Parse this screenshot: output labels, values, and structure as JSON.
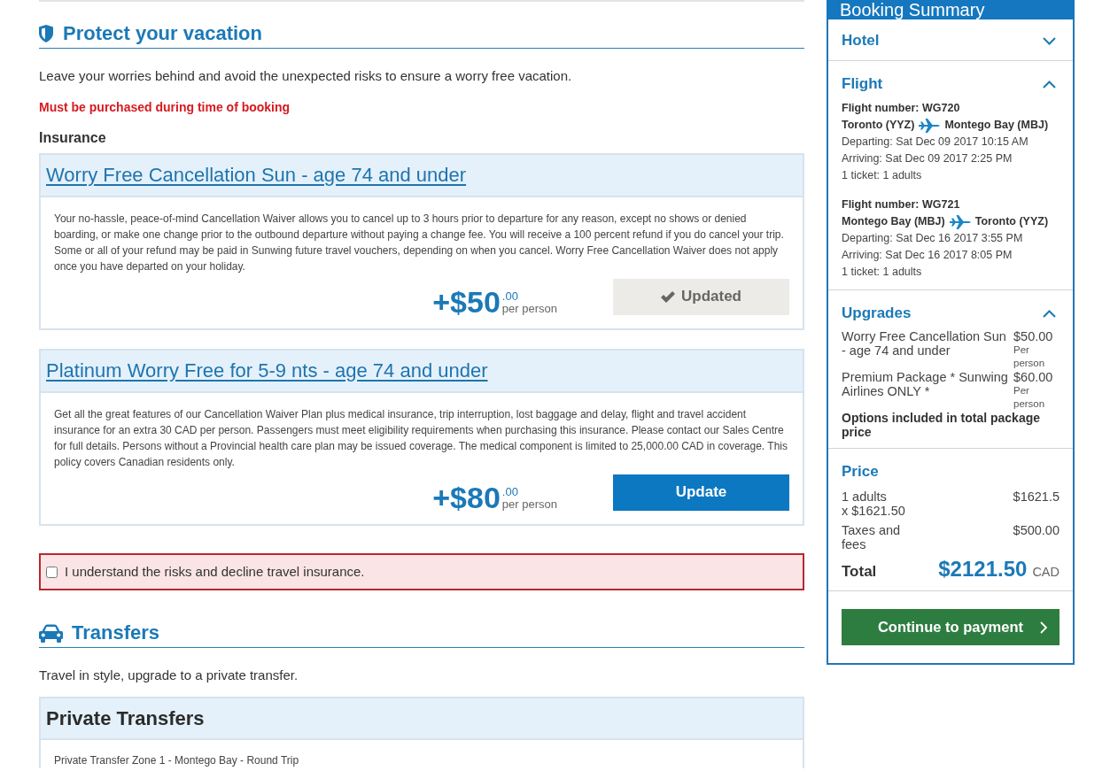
{
  "protect_section": {
    "title": "Protect your vacation",
    "description": "Leave your worries behind and avoid the unexpected risks to ensure a worry free vacation.",
    "warning": "Must be purchased during time of booking",
    "subheading": "Insurance",
    "plans": [
      {
        "title": "Worry Free Cancellation Sun - age 74 and under",
        "description": "Your no-hassle, peace-of-mind Cancellation Waiver allows you to cancel up to 3 hours prior to departure for any reason, except no shows or denied boarding, or make one change prior to the outbound departure without paying a change fee. You will receive a 100 percent refund if you do cancel your trip. Some or all of your refund may be paid in Sunwing future travel vouchers, depending on when you cancel. Worry Free Cancellation Waiver does not apply once you have departed on your holiday.",
        "price": "+$50",
        "cents": ".00",
        "unit": "per person",
        "button": "Updated",
        "selected": true
      },
      {
        "title": "Platinum Worry Free for 5-9 nts - age 74 and under",
        "description": "Get all the great features of our Cancellation Waiver Plan plus medical insurance, trip interruption, lost baggage and delay, flight and travel accident insurance for an extra 30 CAD per person. Passengers must meet eligibility requirements when purchasing this insurance. Please contact our Sales Centre for full details. Persons without a Provincial health care plan may be issued coverage. The medical component is limited to 25,000.00 CAD in coverage. This policy covers Canadian residents only.",
        "price": "+$80",
        "cents": ".00",
        "unit": "per person",
        "button": "Update",
        "selected": false
      }
    ],
    "decline": {
      "label": "I understand the risks and decline travel insurance.",
      "checked": false
    }
  },
  "transfers_section": {
    "title": "Transfers",
    "description": "Travel in style, upgrade to a private transfer.",
    "card": {
      "title": "Private Transfers",
      "items": [
        "Private Transfer Zone 1 - Montego Bay - Round Trip"
      ]
    }
  },
  "booking_summary": {
    "title": "Booking Summary",
    "sections": [
      {
        "kind": "plain",
        "title": "Hotel",
        "expanded": false
      },
      {
        "kind": "flights",
        "title": "Flight",
        "expanded": true,
        "flights": [
          {
            "number": "Flight number: WG720",
            "from": "Toronto (YYZ)",
            "to": "Montego Bay (MBJ)",
            "departing": "Departing: Sat Dec 09 2017 10:15 AM",
            "arriving": "Arriving: Sat Dec 09 2017 2:25 PM",
            "tickets": "1 ticket: 1 adults"
          },
          {
            "number": "Flight number: WG721",
            "from": "Montego Bay (MBJ)",
            "to": "Toronto (YYZ)",
            "departing": "Departing: Sat Dec 16 2017 3:55 PM",
            "arriving": "Arriving: Sat Dec 16 2017 8:05 PM",
            "tickets": "1 ticket: 1 adults"
          }
        ]
      },
      {
        "kind": "upgrades",
        "title": "Upgrades",
        "expanded": true,
        "items": [
          {
            "name": "Worry Free Cancellation Sun - age 74 and under",
            "price": "$50.00",
            "unit": "Per person"
          },
          {
            "name": "Premium Package * Sunwing Airlines ONLY *",
            "price": "$60.00",
            "unit": "Per person"
          }
        ],
        "note": "Options included in total package price"
      },
      {
        "kind": "price",
        "title": "Price",
        "lines": [
          {
            "label": "1 adults",
            "detail": "x $1621.50",
            "amount": "$1621.5"
          },
          {
            "label": "Taxes and fees",
            "amount": "$500.00"
          }
        ],
        "total": {
          "label": "Total",
          "amount": "$2121.50",
          "currency": "CAD"
        }
      }
    ],
    "button": "Continue to payment"
  }
}
